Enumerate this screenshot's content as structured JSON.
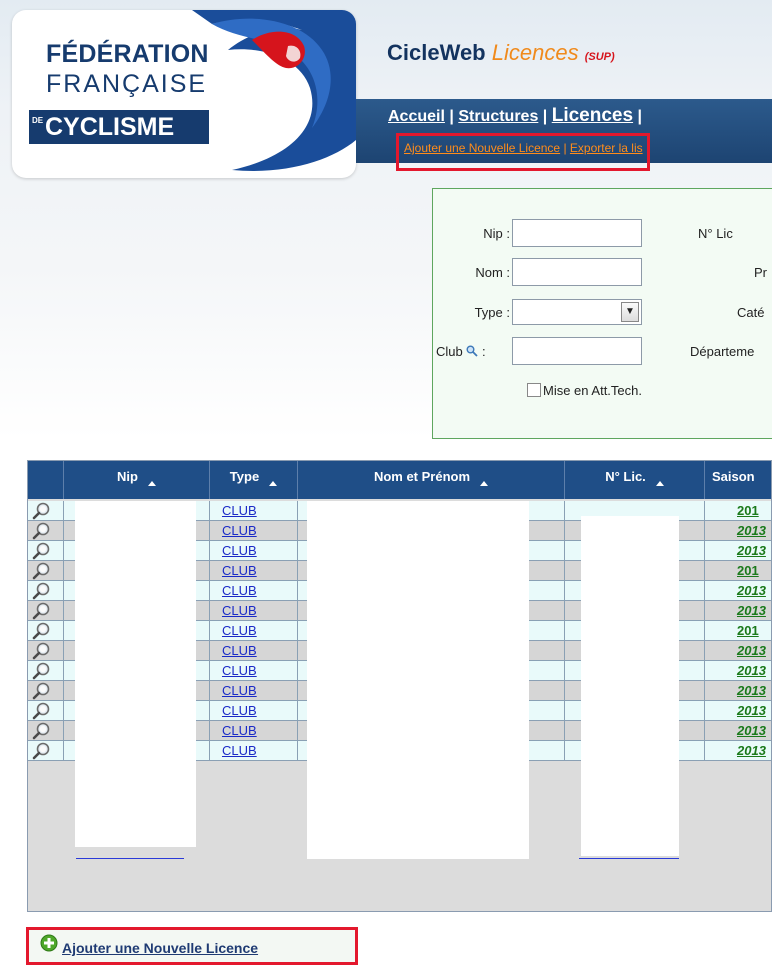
{
  "logo": {
    "line1": "FÉDÉRATION",
    "line2": "FRANÇAISE",
    "line3_prefix": "DE",
    "line3": "CYCLISME"
  },
  "app": {
    "title": "CicleWeb",
    "subtitle": "Licences",
    "sup": "(SUP)"
  },
  "nav": {
    "items": [
      {
        "label": "Accueil"
      },
      {
        "label": "Structures"
      },
      {
        "label": "Licences"
      }
    ],
    "separator": "|",
    "sub": {
      "add_link": "Ajouter une Nouvelle Licence",
      "export_link": "Exporter la lis"
    }
  },
  "filters": {
    "nip_label": "Nip :",
    "nom_label": "Nom :",
    "type_label": "Type :",
    "club_label": "Club",
    "club_colon": ":",
    "nlic_label": "N° Lic",
    "pr_label": "Pr",
    "cat_label": "Caté",
    "dept_label": "Départeme",
    "checkbox_label": "Mise en Att.Tech."
  },
  "table": {
    "headers": [
      "Nip",
      "Type",
      "Nom et Prénom",
      "N° Lic.",
      "Saison"
    ],
    "rows": [
      {
        "type": "CLUB",
        "season": "201",
        "italic": false
      },
      {
        "type": "CLUB",
        "season": "2013",
        "italic": true
      },
      {
        "type": "CLUB",
        "season": "2013",
        "italic": true
      },
      {
        "type": "CLUB",
        "season": "201",
        "italic": false
      },
      {
        "type": "CLUB",
        "season": "2013",
        "italic": true
      },
      {
        "type": "CLUB",
        "season": "2013",
        "italic": true
      },
      {
        "type": "CLUB",
        "season": "201",
        "italic": false
      },
      {
        "type": "CLUB",
        "season": "2013",
        "italic": true
      },
      {
        "type": "CLUB",
        "season": "2013",
        "italic": true
      },
      {
        "type": "CLUB",
        "season": "2013",
        "italic": true
      },
      {
        "type": "CLUB",
        "season": "2013",
        "italic": true
      },
      {
        "type": "CLUB",
        "season": "2013",
        "italic": true
      },
      {
        "type": "CLUB",
        "season": "2013",
        "italic": true
      }
    ]
  },
  "footer": {
    "add_button": "Ajouter une Nouvelle Licence"
  },
  "colors": {
    "brand_navy": "#163b6e",
    "nav_blue": "#1d4472",
    "accent_orange": "#f08a1c",
    "highlight_red": "#e3182d"
  }
}
